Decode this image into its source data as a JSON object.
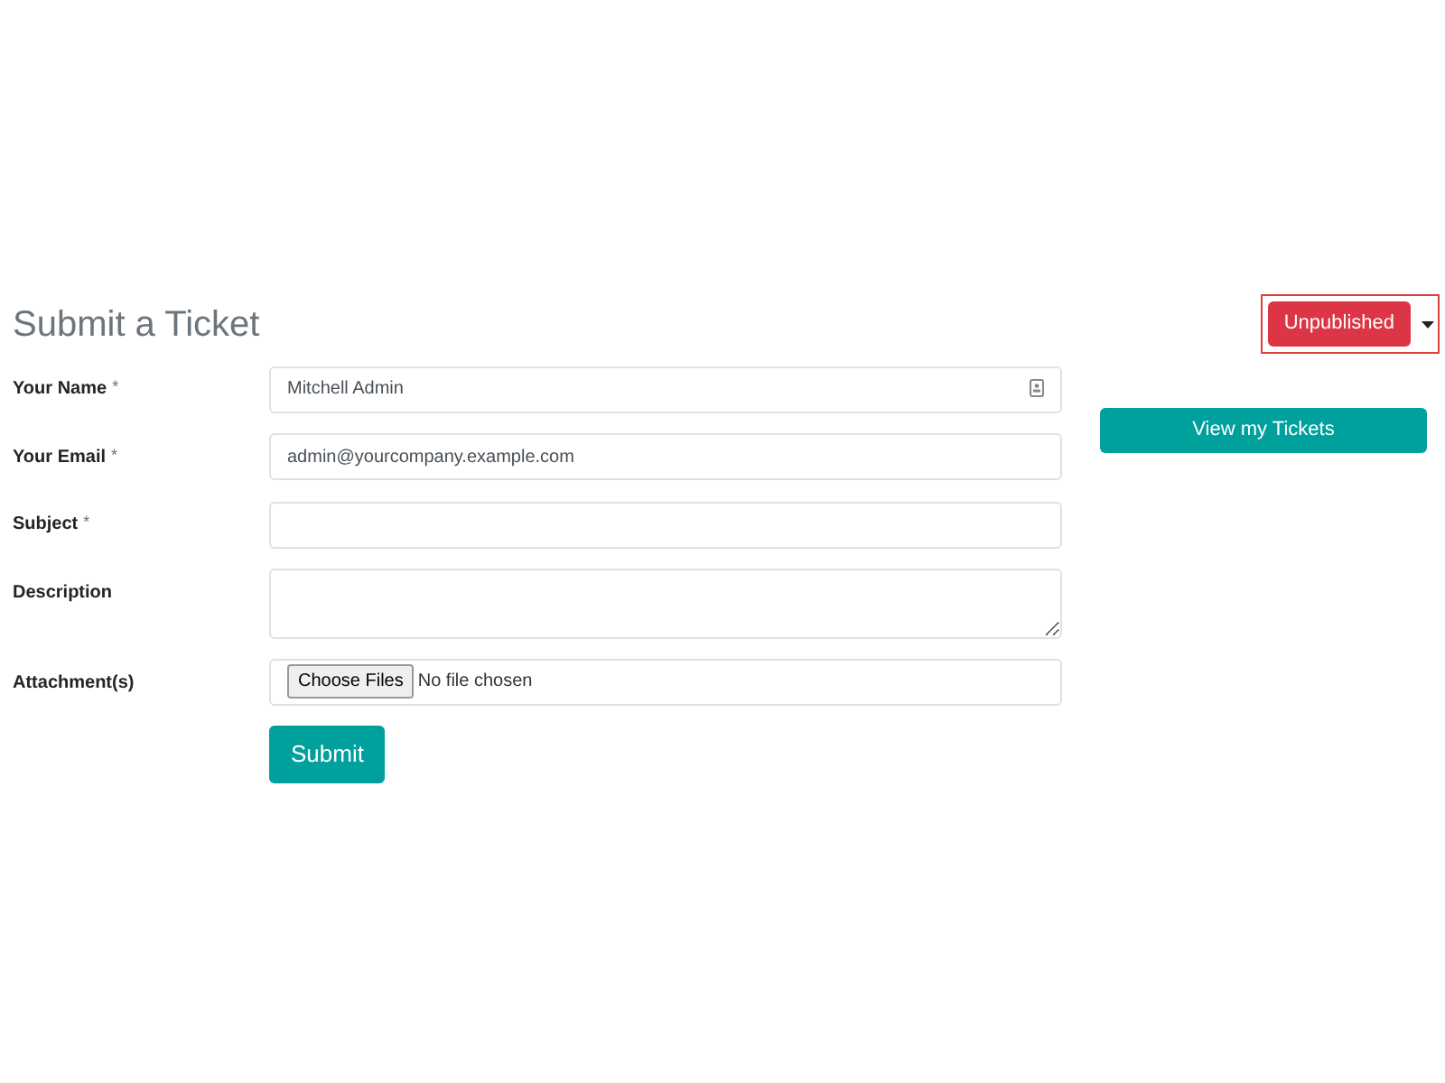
{
  "title": "Submit a Ticket",
  "publish": {
    "label": "Unpublished",
    "published": false
  },
  "fields": [
    {
      "kind": "text",
      "label": "Your Name",
      "marker": "*",
      "value": "Mitchell Admin",
      "has_contact_icon": true
    },
    {
      "kind": "text",
      "label": "Your Email",
      "marker": "*",
      "value": "admin@yourcompany.example.com"
    },
    {
      "kind": "text",
      "label": "Subject",
      "marker": "*"
    },
    {
      "kind": "textarea",
      "label": "Description"
    },
    {
      "kind": "file",
      "label": "Attachment(s)",
      "button": "Choose Files",
      "status": "No file chosen"
    }
  ],
  "submit": "Submit",
  "view_tickets": "View my Tickets"
}
